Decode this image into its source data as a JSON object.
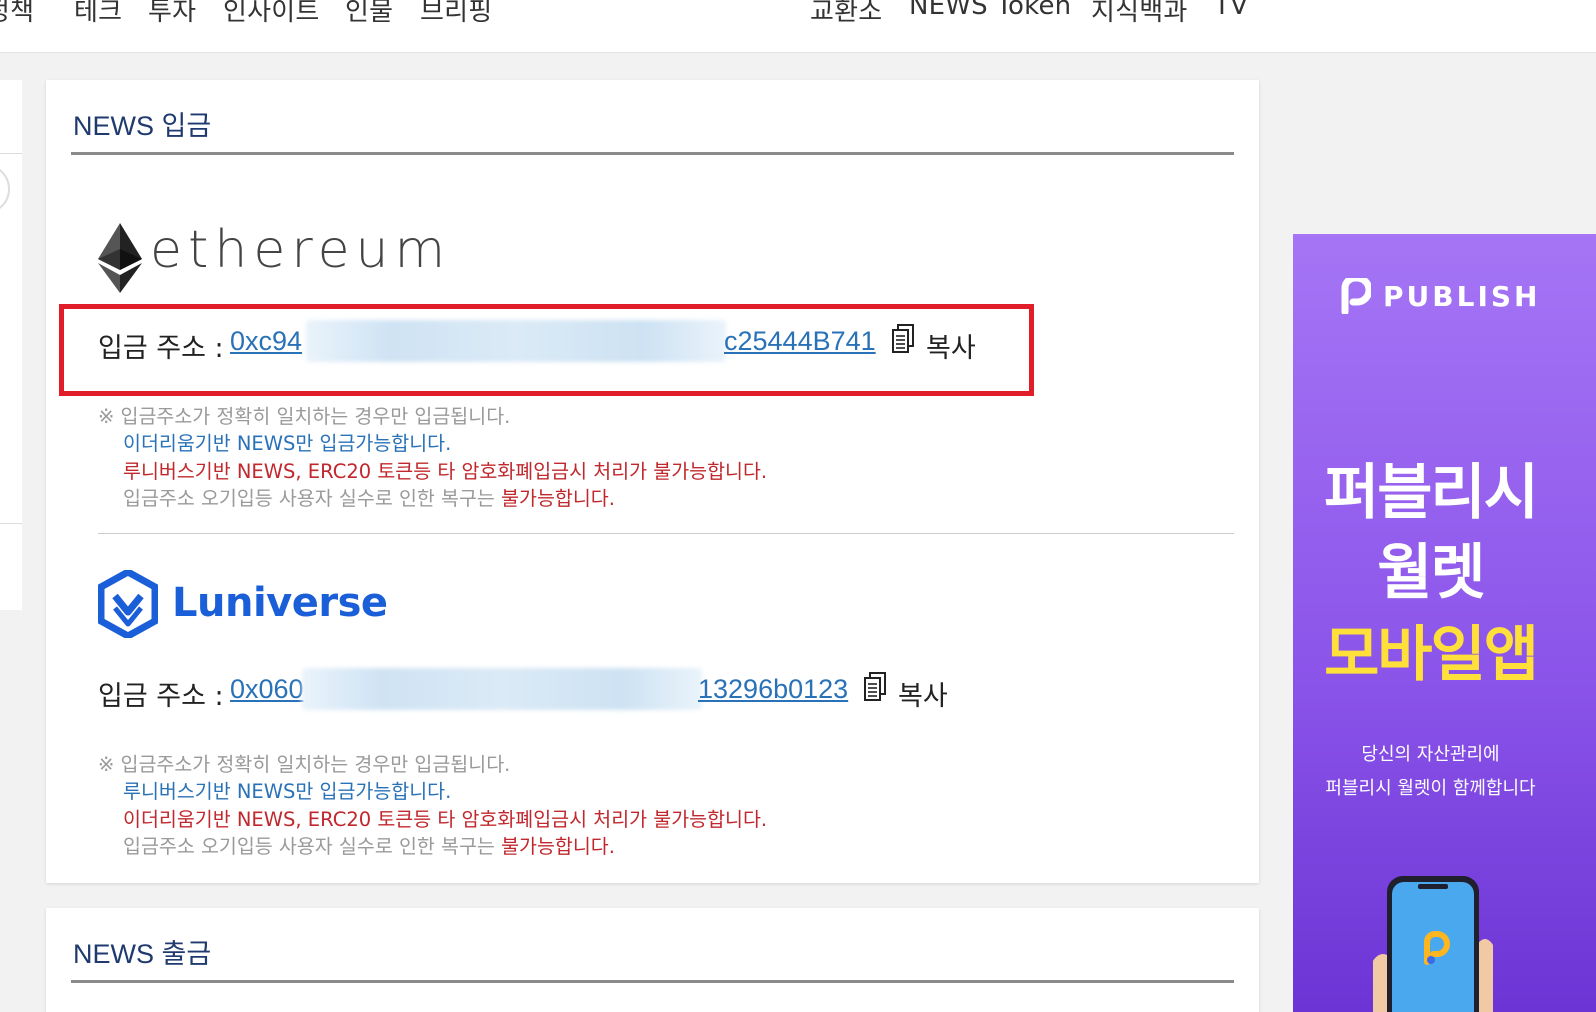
{
  "nav": {
    "left_items": [
      "정책",
      "테크",
      "투자",
      "인사이트",
      "인물",
      "브리핑"
    ],
    "right_items": [
      "교환소",
      "NEWS Token",
      "지식백과",
      "TV"
    ]
  },
  "deposit": {
    "title": "NEWS 입금",
    "ethereum": {
      "logo_text": "ethereum",
      "address_label": "입금 주소 :",
      "address_start": "0xc94",
      "address_end": "c25444B741",
      "copy_label": "복사",
      "notes": [
        {
          "text": "※ 입금주소가 정확히 일치하는 경우만 입금됩니다.",
          "color": "gray"
        },
        {
          "text": "이더리움기반 NEWS만 입금가능합니다.",
          "color": "blue"
        },
        {
          "text": "루니버스기반 NEWS, ERC20 토큰등 타 암호화폐입금시 처리가 불가능합니다.",
          "color": "red"
        }
      ],
      "last_note_prefix": "입금주소 오기입등 사용자 실수로 인한 복구는 ",
      "last_note_suffix": "불가능합니다."
    },
    "luniverse": {
      "logo_text": "Luniverse",
      "address_label": "입금 주소 :",
      "address_start": "0x060",
      "address_end": "13296b0123",
      "copy_label": "복사",
      "notes": [
        {
          "text": "※ 입금주소가 정확히 일치하는 경우만 입금됩니다.",
          "color": "gray"
        },
        {
          "text": "루니버스기반 NEWS만 입금가능합니다.",
          "color": "blue"
        },
        {
          "text": "이더리움기반 NEWS, ERC20 토큰등 타 암호화폐입금시 처리가 불가능합니다.",
          "color": "red"
        }
      ],
      "last_note_prefix": "입금주소 오기입등 사용자 실수로 인한 복구는 ",
      "last_note_suffix": "불가능합니다."
    }
  },
  "withdraw": {
    "title": "NEWS 출금"
  },
  "ad": {
    "brand": "PUBLISH",
    "headline_1": "퍼블리시",
    "headline_2": "월렛",
    "headline_3": "모바일앱",
    "sub_1": "당신의 자산관리에",
    "sub_2": "퍼블리시 월렛이 함께합니다",
    "accent_color": "#ffe03a",
    "bg_color": "#9a62f0"
  },
  "colors": {
    "link": "#2a72b8",
    "warning": "#c0282d",
    "highlight": "#e11d2a",
    "title": "#1f3a6e"
  }
}
